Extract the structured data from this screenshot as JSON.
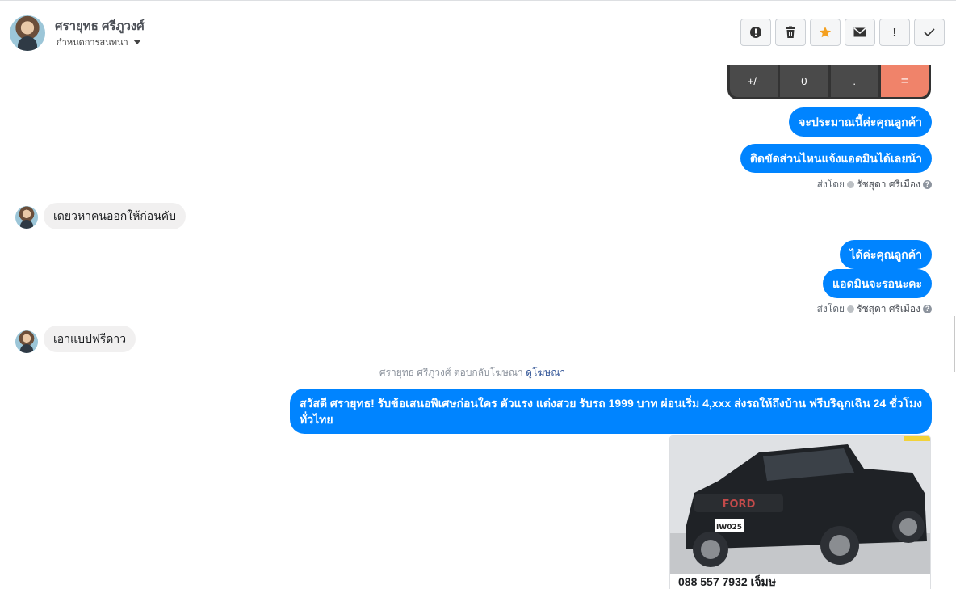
{
  "header": {
    "contact_name": "ศรายุทธ ศรีภูวงศ์",
    "status_label": "กำหนดการสนทนา"
  },
  "toolbar": {
    "spam_icon": "!",
    "delete_icon": "🗑",
    "star_icon": "★",
    "mail_icon": "✉",
    "priority_icon": "!",
    "done_icon": "✓"
  },
  "calculator": {
    "keys": [
      "+/-",
      "0",
      ".",
      "="
    ]
  },
  "messages": {
    "m1": "จะประมาณนี้ค่ะคุณลูกค้า",
    "m2": "ติดขัดส่วนไหนแจ้งแอดมินได้เลยน้า",
    "sent1": {
      "prefix": "ส่งโดย",
      "agent": "รัชสุดา ศรีเมือง"
    },
    "m3": "เดยวหาคนออกให้ก่อนคับ",
    "m4": "ได้ค่ะคุณลูกค้า",
    "m5": "แอดมินจะรอนะคะ",
    "sent2": {
      "prefix": "ส่งโดย",
      "agent": "รัชสุดา ศรีเมือง"
    },
    "m6": "เอาแบปฟรีดาว",
    "reply_note": {
      "text": "ศรายุทธ ศรีภูวงศ์ ตอบกลับโฆษณา",
      "link": "ดูโฆษณา"
    },
    "m7": "สวัสดี ศรายุทธ! รับข้อเสนอพิเศษก่อนใคร ตัวแรง แต่งสวย รับรถ 1999 บาท ผ่อนเริ่ม 4,xxx ส่งรถให้ถึงบ้าน ฟรีบริฉุกเฉิน 24 ชั่วโมงทั่วไทย",
    "ad_plate": "IW025",
    "ad_grille": "FORD",
    "ad_phone": "088 557 7932 เจ็มษ"
  },
  "colors": {
    "outgoing_bubble": "#0084ff",
    "incoming_bubble": "#f1f0f0",
    "calc_equals": "#f0836a",
    "star": "#f4a020"
  }
}
